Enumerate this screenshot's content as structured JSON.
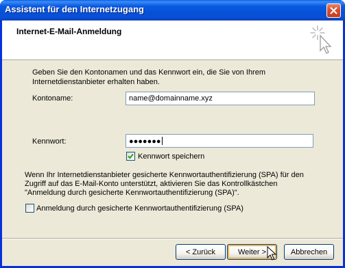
{
  "window": {
    "title": "Assistent für den Internetzugang"
  },
  "header": {
    "title": "Internet-E-Mail-Anmeldung",
    "icon": "wizard-sparkle-icon"
  },
  "body": {
    "intro": "Geben Sie den Kontonamen und das Kennwort ein, die Sie von Ihrem Internetdienstanbieter erhalten haben.",
    "account_label": "Kontoname:",
    "account_value": "name@domainname.xyz",
    "password_label": "Kennwort:",
    "password_value": "●●●●●●●",
    "remember_label": "Kennwort speichern",
    "remember_checked": true,
    "spa_info": "Wenn Ihr Internetdienstanbieter gesicherte Kennwortauthentifizierung (SPA) für den Zugriff auf das E-Mail-Konto unterstützt, aktivieren Sie das Kontrollkästchen \"Anmeldung durch gesicherte Kennwortauthentifizierung (SPA)\".",
    "spa_label": "Anmeldung durch gesicherte Kennwortauthentifizierung (SPA)",
    "spa_checked": false
  },
  "buttons": {
    "back": "< Zurück",
    "next": "Weiter >",
    "cancel": "Abbrechen"
  },
  "colors": {
    "titlebar": "#0a5ae0",
    "dialog_bg": "#ece9d8",
    "close": "#c53b1e"
  }
}
